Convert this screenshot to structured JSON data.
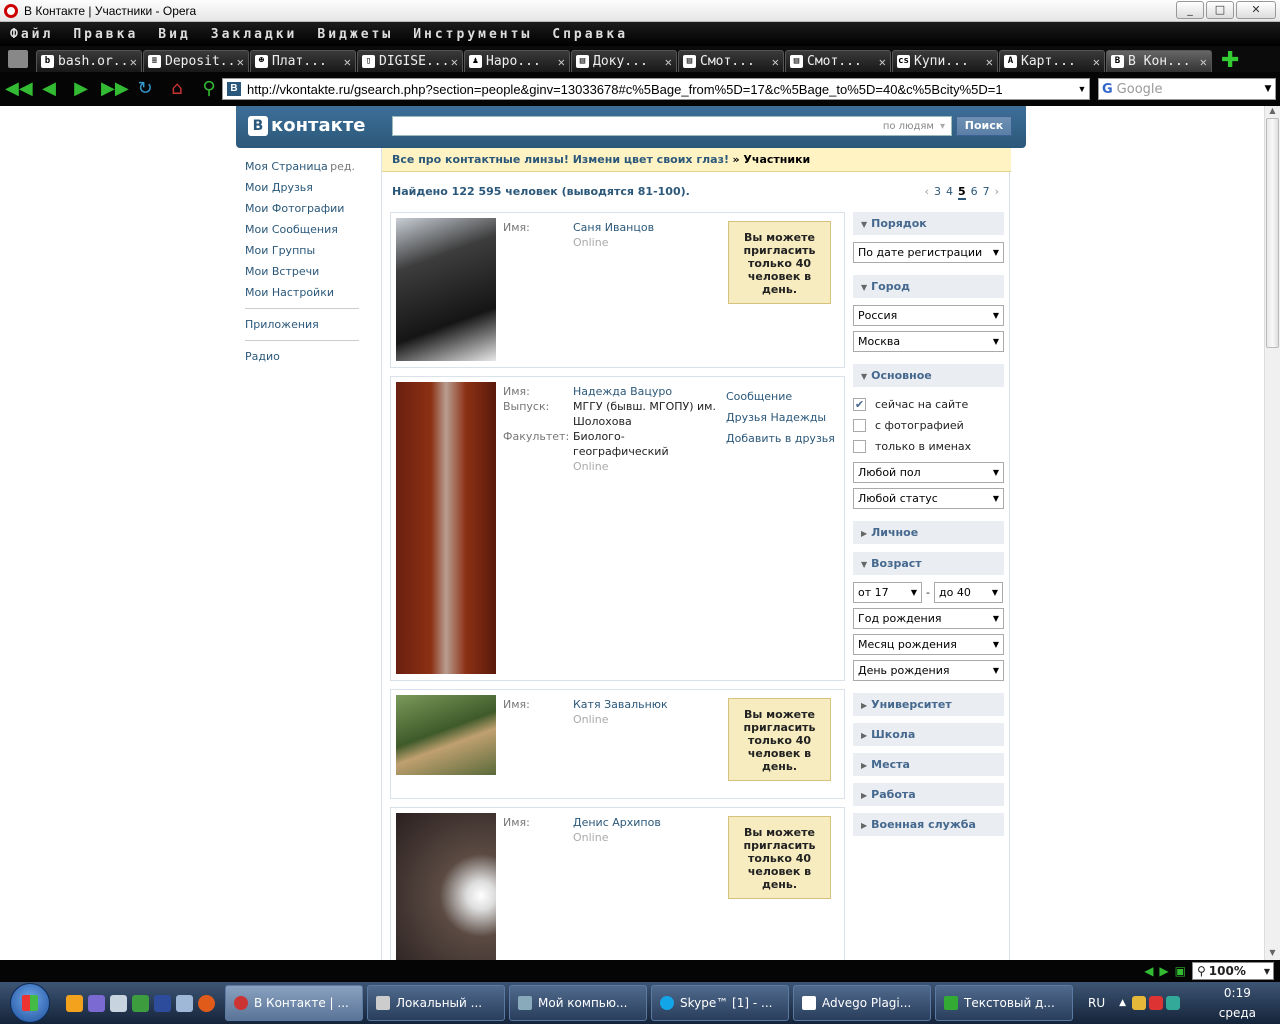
{
  "window": {
    "title": "В Контакте | Участники - Opera",
    "min": "_",
    "max": "□",
    "close": "✕"
  },
  "menu": [
    "Файл",
    "Правка",
    "Вид",
    "Закладки",
    "Виджеты",
    "Инструменты",
    "Справка"
  ],
  "tabs": [
    {
      "fav": "b",
      "label": "bash.or..."
    },
    {
      "fav": "≡",
      "label": "Deposit..."
    },
    {
      "fav": "☻",
      "label": "Плат..."
    },
    {
      "fav": "▯",
      "label": "DIGISE..."
    },
    {
      "fav": "♟",
      "label": "Наро..."
    },
    {
      "fav": "▤",
      "label": "Доку..."
    },
    {
      "fav": "▤",
      "label": "Смот..."
    },
    {
      "fav": "▤",
      "label": "Смот..."
    },
    {
      "fav": "cs",
      "label": "Купи..."
    },
    {
      "fav": "A",
      "label": "Карт..."
    },
    {
      "fav": "B",
      "label": "В Кон...",
      "active": true
    }
  ],
  "address": {
    "url": "http://vkontakte.ru/gsearch.php?section=people&ginv=13033678#c%5Bage_from%5D=17&c%5Bage_to%5D=40&c%5Bcity%5D=1",
    "search_placeholder": "Google"
  },
  "vk": {
    "logo": "контакте",
    "search_scope": "по людям",
    "search_button": "Поиск",
    "nav": [
      {
        "label": "Моя Страница",
        "edit": "ред."
      },
      {
        "label": "Мои Друзья"
      },
      {
        "label": "Мои Фотографии"
      },
      {
        "label": "Мои Сообщения"
      },
      {
        "label": "Мои Группы"
      },
      {
        "label": "Мои Встречи"
      },
      {
        "label": "Мои Настройки"
      }
    ],
    "nav_apps": "Приложения",
    "nav_radio": "Радио",
    "banner_ad": "Все про контактные линзы! Измени цвет своих глаз!",
    "banner_crumb": "» Участники",
    "found": "Найдено 122 595 человек (выводятся 81-100).",
    "pager": {
      "prev": "‹",
      "pages": [
        "3",
        "4",
        "5",
        "6",
        "7"
      ],
      "current": "5",
      "next": "›"
    },
    "invite_text": "Вы можете пригласить только 40 человек в день.",
    "labels": {
      "name": "Имя:",
      "grad": "Выпуск:",
      "faculty": "Факультет:",
      "online": "Online"
    },
    "people": [
      {
        "name": "Саня Иванцов"
      },
      {
        "name": "Надежда Вацуро",
        "grad": "МГГУ (бывш. МГОПУ) им. Шолохова",
        "faculty": "Биолого-географический",
        "actions": [
          "Сообщение",
          "Друзья Надежды",
          "Добавить в друзья"
        ]
      },
      {
        "name": "Катя Завальнюк"
      },
      {
        "name": "Денис Архипов"
      }
    ],
    "filters": {
      "order": "Порядок",
      "order_value": "По дате регистрации",
      "city": "Город",
      "country_value": "Россия",
      "city_value": "Москва",
      "basic": "Основное",
      "checks": [
        {
          "label": "сейчас на сайте",
          "checked": true
        },
        {
          "label": "с фотографией",
          "checked": false
        },
        {
          "label": "только в именах",
          "checked": false
        }
      ],
      "sex_value": "Любой пол",
      "status_value": "Любой статус",
      "personal": "Личное",
      "age": "Возраст",
      "age_from": "от 17",
      "age_dash": "-",
      "age_to": "до 40",
      "birth_year": "Год рождения",
      "birth_month": "Месяц рождения",
      "birth_day": "День рождения",
      "university": "Университет",
      "school": "Школа",
      "places": "Места",
      "work": "Работа",
      "military": "Военная служба"
    }
  },
  "status": {
    "zoom": "100%"
  },
  "taskbar": {
    "items": [
      {
        "label": "В Контакте | ...",
        "active": true
      },
      {
        "label": "Локальный ..."
      },
      {
        "label": "Мой компью..."
      },
      {
        "label": "Skype™ [1] - ..."
      },
      {
        "label": "Advego Plagi..."
      },
      {
        "label": "Текстовый д..."
      }
    ],
    "lang": "RU",
    "time": "0:19",
    "day": "среда"
  }
}
